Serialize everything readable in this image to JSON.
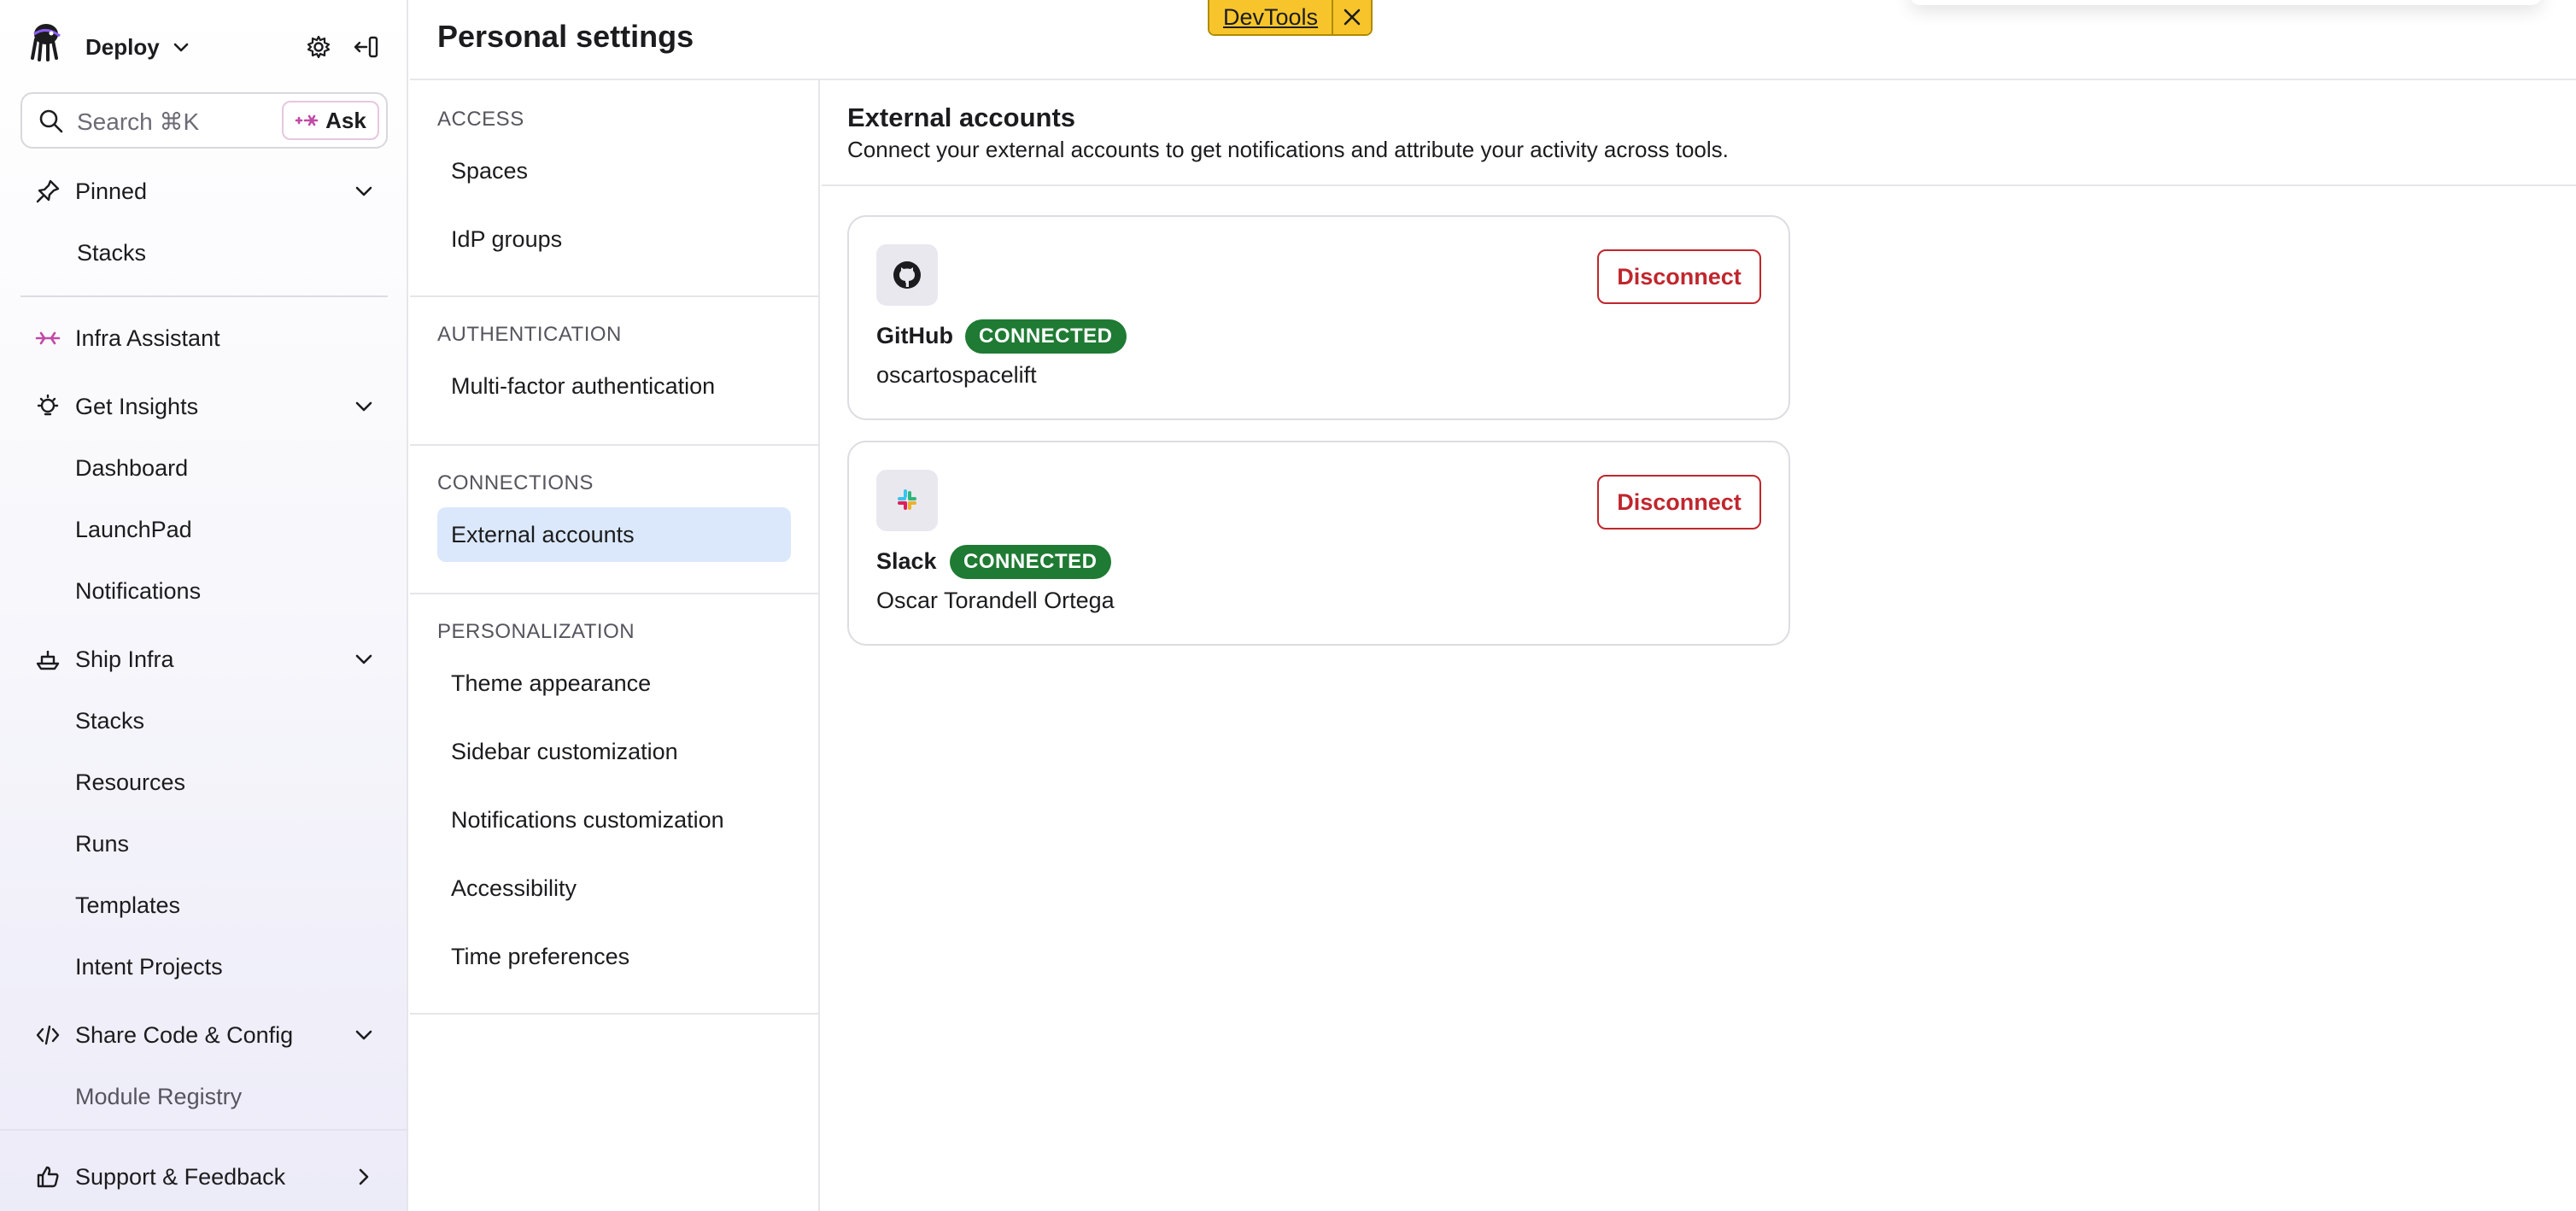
{
  "devtools": {
    "label": "DevTools"
  },
  "sidebar": {
    "workspace": "Deploy",
    "search_placeholder": "Search ⌘K",
    "ask_label": "Ask",
    "pinned": {
      "label": "Pinned",
      "items": [
        "Stacks"
      ]
    },
    "infra_assistant": "Infra Assistant",
    "get_insights": {
      "label": "Get Insights",
      "items": [
        "Dashboard",
        "LaunchPad",
        "Notifications"
      ]
    },
    "ship_infra": {
      "label": "Ship Infra",
      "items": [
        "Stacks",
        "Resources",
        "Runs",
        "Templates",
        "Intent Projects"
      ]
    },
    "share_code": {
      "label": "Share Code & Config",
      "items": [
        "Module Registry"
      ]
    },
    "support": "Support & Feedback"
  },
  "settings": {
    "title": "Personal settings",
    "sections": [
      {
        "heading": "ACCESS",
        "items": [
          "Spaces",
          "IdP groups"
        ]
      },
      {
        "heading": "AUTHENTICATION",
        "items": [
          "Multi-factor authentication"
        ]
      },
      {
        "heading": "CONNECTIONS",
        "items": [
          "External accounts"
        ]
      },
      {
        "heading": "PERSONALIZATION",
        "items": [
          "Theme appearance",
          "Sidebar customization",
          "Notifications customization",
          "Accessibility",
          "Time preferences"
        ]
      }
    ],
    "active_item": "External accounts"
  },
  "main": {
    "title": "External accounts",
    "description": "Connect your external accounts to get notifications and attribute your activity across tools.",
    "accounts": [
      {
        "app": "GitHub",
        "status": "CONNECTED",
        "account": "oscartospacelift",
        "action": "Disconnect",
        "icon": "github-icon"
      },
      {
        "app": "Slack",
        "status": "CONNECTED",
        "account": "Oscar Torandell Ortega",
        "action": "Disconnect",
        "icon": "slack-icon"
      }
    ]
  },
  "colors": {
    "connected_badge": "#1f7a33",
    "disconnect": "#c0262d",
    "active_item_bg": "#dbe8fb",
    "devtools_bg": "#f7c52b"
  }
}
